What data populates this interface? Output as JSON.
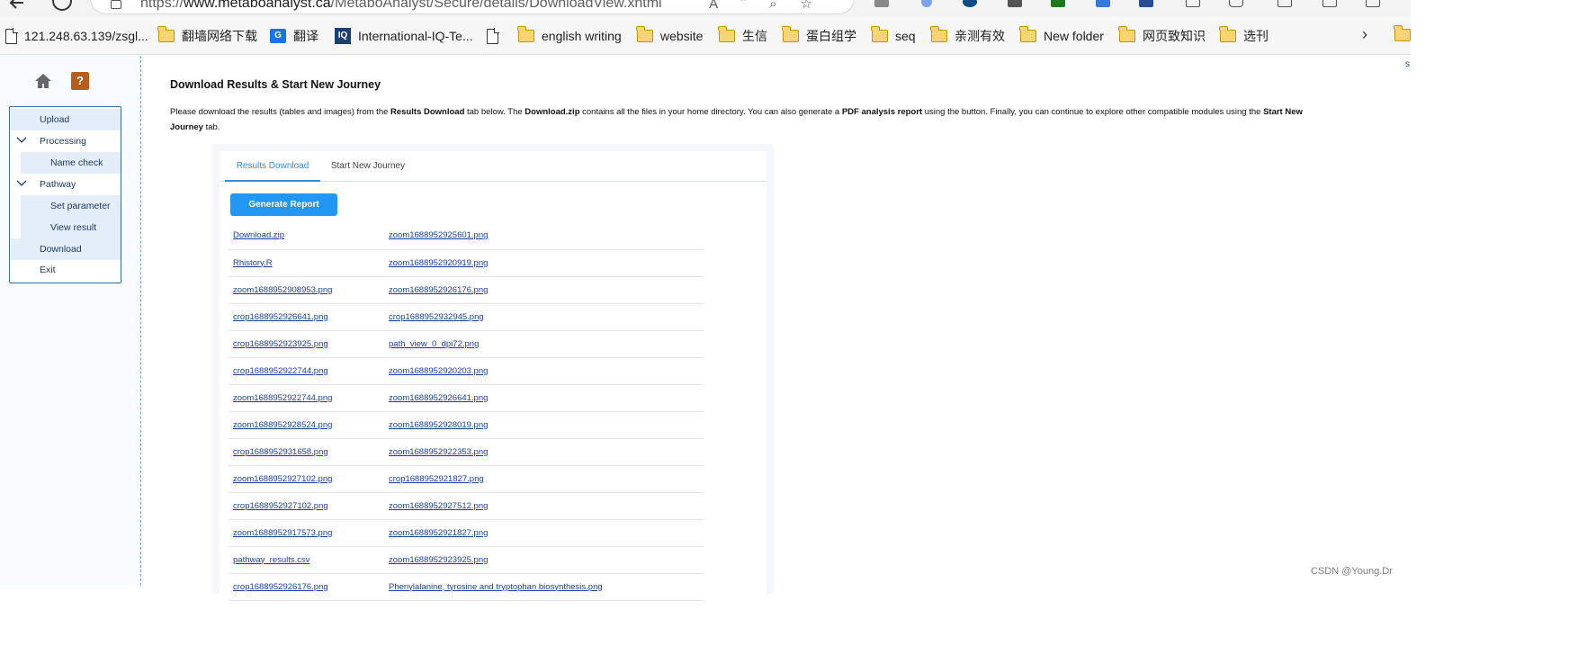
{
  "browser": {
    "url_prefix": "https://",
    "url_host": "www.metaboanalyst.ca",
    "url_path": "/MetaboAnalyst/Secure/details/DownloadView.xhtml",
    "read_aloud": "Aˆ"
  },
  "bookmarks": [
    {
      "label": "121.248.63.139/zsgl...",
      "icon": "page-icon"
    },
    {
      "label": "翻墙网络下载",
      "icon": "folder-icon"
    },
    {
      "label": "翻译",
      "icon": "translate-icon"
    },
    {
      "label": "International-IQ-Te...",
      "icon": "iq-icon"
    },
    {
      "label": "",
      "icon": "page-icon"
    },
    {
      "label": "english writing",
      "icon": "folder-icon"
    },
    {
      "label": "website",
      "icon": "folder-icon"
    },
    {
      "label": "生信",
      "icon": "folder-icon"
    },
    {
      "label": "蛋白组学",
      "icon": "folder-icon"
    },
    {
      "label": "seq",
      "icon": "folder-icon"
    },
    {
      "label": "亲测有效",
      "icon": "folder-icon"
    },
    {
      "label": "New folder",
      "icon": "folder-icon"
    },
    {
      "label": "网页致知识",
      "icon": "folder-icon"
    },
    {
      "label": "选刊",
      "icon": "folder-icon"
    }
  ],
  "sidebar": {
    "help_glyph": "?",
    "items": [
      {
        "label": "Upload"
      },
      {
        "label": "Processing"
      },
      {
        "label": "Name check"
      },
      {
        "label": "Pathway"
      },
      {
        "label": "Set parameter"
      },
      {
        "label": "View result"
      },
      {
        "label": "Download"
      },
      {
        "label": "Exit"
      }
    ]
  },
  "main": {
    "title": "Download Results & Start New Journey",
    "intro": {
      "p1": "Please download the results (tables and images) from the ",
      "b1": "Results Download",
      "p2": " tab below. The ",
      "b2": "Download.zip",
      "p3": " contains all the files in your home directory. You can also generate a ",
      "b3": "PDF analysis report",
      "p4": " using the button. Finally, you can continue to explore other compatible modules using the ",
      "b4": "Start New Journey",
      "p5": " tab."
    },
    "tabs": [
      {
        "label": "Results Download",
        "active": true
      },
      {
        "label": "Start New Journey",
        "active": false
      }
    ],
    "generate_button": "Generate Report",
    "files": [
      [
        "Download.zip",
        "zoom1688952925601.png"
      ],
      [
        "Rhistory.R",
        "zoom1688952920919.png"
      ],
      [
        "zoom1688952908953.png",
        "zoom1688952926176.png"
      ],
      [
        "crop1688952926641.png",
        "crop1688952932945.png"
      ],
      [
        "crop1688952923925.png",
        "path_view_0_dpi72.png"
      ],
      [
        "crop1688952922744.png",
        "zoom1688952920203.png"
      ],
      [
        "zoom1688952922744.png",
        "zoom1688952926641.png"
      ],
      [
        "zoom1688952928524.png",
        "zoom1688952928019.png"
      ],
      [
        "crop1688952931658.png",
        "zoom1688952922353.png"
      ],
      [
        "zoom1688952927102.png",
        "crop1688952921827.png"
      ],
      [
        "crop1688952927102.png",
        "zoom1688952927512.png"
      ],
      [
        "zoom1688952917573.png",
        "zoom1688952921827.png"
      ],
      [
        "pathway_results.csv",
        "zoom1688952923925.png"
      ],
      [
        "crop1688952926176.png",
        "Phenylalanine, tyrosine and tryptophan biosynthesis.png"
      ]
    ]
  },
  "watermark": "CSDN @Young.Dr",
  "colors": {
    "accent": "#2196f3",
    "link": "#1a3fa0",
    "nav_border": "#3b6ea8",
    "nav_highlight": "#e4eef9"
  }
}
